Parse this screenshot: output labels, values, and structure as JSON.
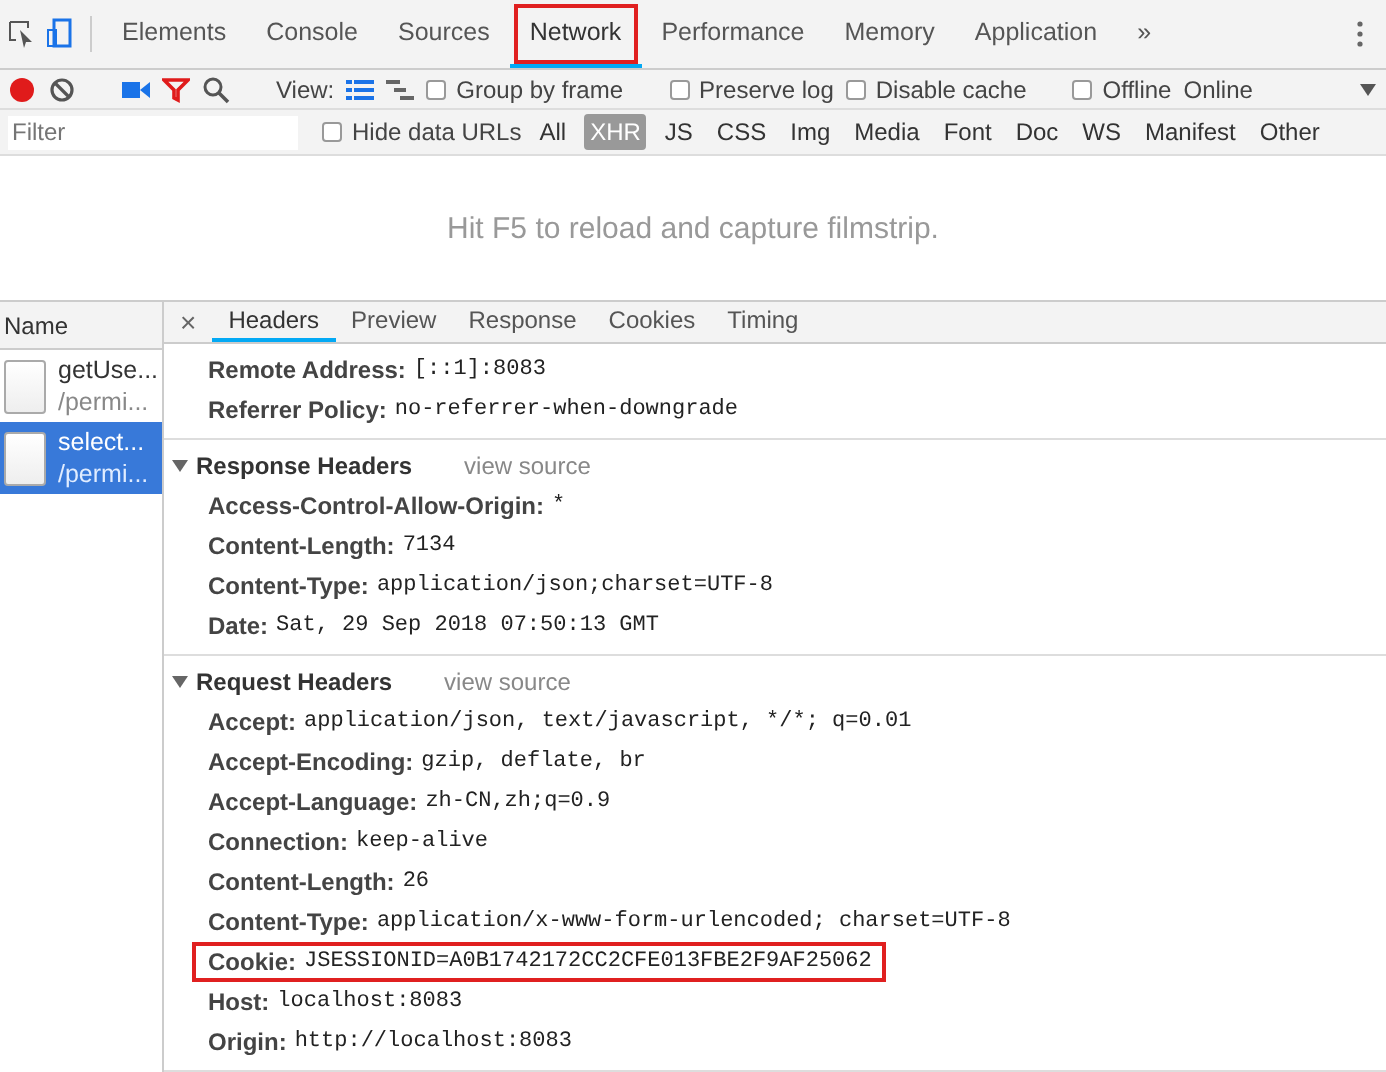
{
  "tabs": [
    {
      "label": "Elements",
      "selected": false,
      "highlighted": false
    },
    {
      "label": "Console",
      "selected": false,
      "highlighted": false
    },
    {
      "label": "Sources",
      "selected": false,
      "highlighted": false
    },
    {
      "label": "Network",
      "selected": true,
      "highlighted": true
    },
    {
      "label": "Performance",
      "selected": false,
      "highlighted": false
    },
    {
      "label": "Memory",
      "selected": false,
      "highlighted": false
    },
    {
      "label": "Application",
      "selected": false,
      "highlighted": false
    }
  ],
  "overflow": "»",
  "toolbar": {
    "recording": true,
    "filter_active": true,
    "view_label": "View:",
    "large_rows": true,
    "options": [
      {
        "label": "Group by frame",
        "checked": false
      },
      {
        "label": "Preserve log",
        "checked": false
      },
      {
        "label": "Disable cache",
        "checked": false
      },
      {
        "label": "Offline",
        "checked": false
      }
    ],
    "throttle": "Online"
  },
  "filter": {
    "placeholder": "Filter",
    "hide_data_urls": {
      "label": "Hide data URLs",
      "checked": false
    },
    "types": [
      {
        "label": "All",
        "selected": false
      },
      {
        "label": "XHR",
        "selected": true
      },
      {
        "label": "JS",
        "selected": false
      },
      {
        "label": "CSS",
        "selected": false
      },
      {
        "label": "Img",
        "selected": false
      },
      {
        "label": "Media",
        "selected": false
      },
      {
        "label": "Font",
        "selected": false
      },
      {
        "label": "Doc",
        "selected": false
      },
      {
        "label": "WS",
        "selected": false
      },
      {
        "label": "Manifest",
        "selected": false
      },
      {
        "label": "Other",
        "selected": false
      }
    ]
  },
  "filmstrip_hint": "Hit F5 to reload and capture filmstrip.",
  "requests": {
    "header": "Name",
    "items": [
      {
        "name": "getUse...",
        "path": "/permi...",
        "selected": false
      },
      {
        "name": "select...",
        "path": "/permi...",
        "selected": true
      }
    ]
  },
  "detail_tabs": {
    "close": "×",
    "tabs": [
      {
        "label": "Headers",
        "selected": true
      },
      {
        "label": "Preview",
        "selected": false
      },
      {
        "label": "Response",
        "selected": false
      },
      {
        "label": "Cookies",
        "selected": false
      },
      {
        "label": "Timing",
        "selected": false
      }
    ]
  },
  "sections": [
    {
      "rows": [
        {
          "name": "Remote Address:",
          "value": "[::1]:8083",
          "highlighted": false
        },
        {
          "name": "Referrer Policy:",
          "value": "no-referrer-when-downgrade",
          "highlighted": false
        }
      ]
    },
    {
      "title": "Response Headers",
      "view_source": "view source",
      "expanded": true,
      "rows": [
        {
          "name": "Access-Control-Allow-Origin:",
          "value": "*",
          "highlighted": false
        },
        {
          "name": "Content-Length:",
          "value": "7134",
          "highlighted": false
        },
        {
          "name": "Content-Type:",
          "value": "application/json;charset=UTF-8",
          "highlighted": false
        },
        {
          "name": "Date:",
          "value": "Sat, 29 Sep 2018 07:50:13 GMT",
          "highlighted": false
        }
      ]
    },
    {
      "title": "Request Headers",
      "view_source": "view source",
      "expanded": true,
      "rows": [
        {
          "name": "Accept:",
          "value": "application/json, text/javascript, */*; q=0.01",
          "highlighted": false
        },
        {
          "name": "Accept-Encoding:",
          "value": "gzip, deflate, br",
          "highlighted": false
        },
        {
          "name": "Accept-Language:",
          "value": "zh-CN,zh;q=0.9",
          "highlighted": false
        },
        {
          "name": "Connection:",
          "value": "keep-alive",
          "highlighted": false
        },
        {
          "name": "Content-Length:",
          "value": "26",
          "highlighted": false
        },
        {
          "name": "Content-Type:",
          "value": "application/x-www-form-urlencoded; charset=UTF-8",
          "highlighted": false
        },
        {
          "name": "Cookie:",
          "value": "JSESSIONID=A0B1742172CC2CFE013FBE2F9AF25062",
          "highlighted": true
        },
        {
          "name": "Host:",
          "value": "localhost:8083",
          "highlighted": false
        },
        {
          "name": "Origin:",
          "value": "http://localhost:8083",
          "highlighted": false
        }
      ]
    }
  ]
}
